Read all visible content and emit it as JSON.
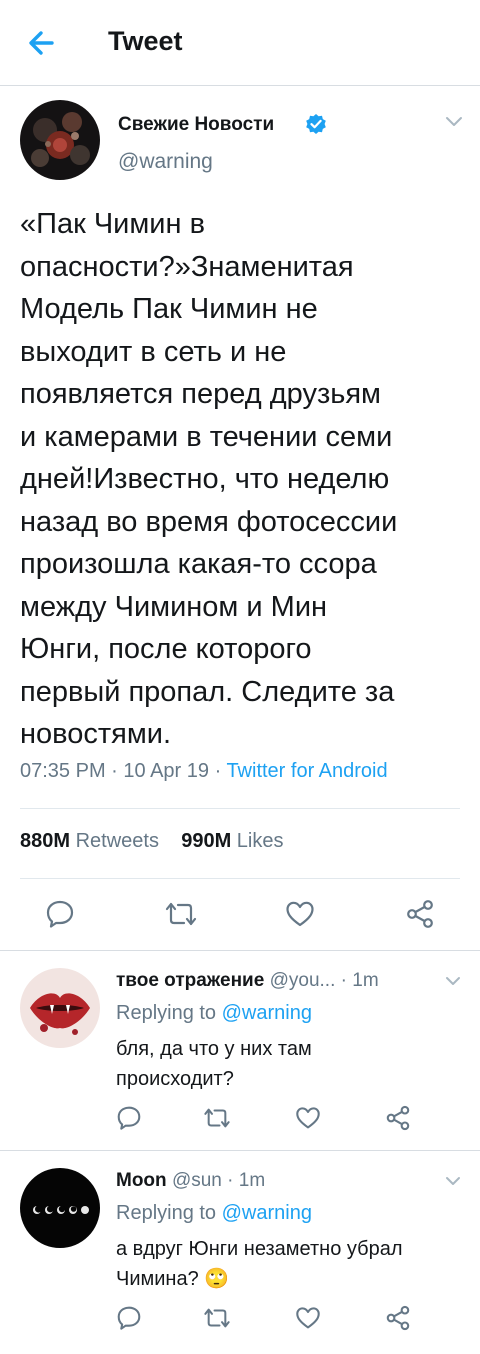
{
  "header": {
    "title": "Tweet"
  },
  "tweet": {
    "author_name": "Свежие Новости",
    "author_handle": "@warning",
    "text_lines": [
      "«Пак Чимин в",
      "опасности?»Знаменитая",
      "Модель Пак Чимин не",
      "выходит в сеть и не",
      "появляется перед друзьям",
      "и камерами в течении семи",
      "дней!Известно, что неделю",
      "назад во время фотосессии",
      "произошла какая-то ссора",
      "между Чимином и Мин",
      "Юнги, после которого",
      "первый пропал. Следите за",
      "новостями."
    ],
    "time": "07:35 PM",
    "date": "10 Apr 19",
    "source": "Twitter for Android",
    "retweets_count": "880M",
    "retweets_label": "Retweets",
    "likes_count": "990M",
    "likes_label": "Likes"
  },
  "replies": [
    {
      "name": "твое отражение",
      "handle": "@you...",
      "time": "1m",
      "replying_prefix": "Replying to",
      "replying_to": "@warning",
      "text_lines": [
        "бля, да что у них там",
        "происходит?"
      ]
    },
    {
      "name": "Moon",
      "handle": "@sun",
      "time": "1m",
      "replying_prefix": "Replying to",
      "replying_to": "@warning",
      "text_lines": [
        "а вдруг Юнги незаметно убрал",
        "Чимина? 🙄"
      ]
    }
  ],
  "colors": {
    "accent": "#1da1f2",
    "text": "#14171a",
    "secondary": "#657786",
    "divider": "#e1e8ed"
  },
  "icons": [
    "back-arrow-icon",
    "verified-badge-icon",
    "chevron-down-icon",
    "reply-icon",
    "retweet-icon",
    "like-icon",
    "share-icon"
  ]
}
